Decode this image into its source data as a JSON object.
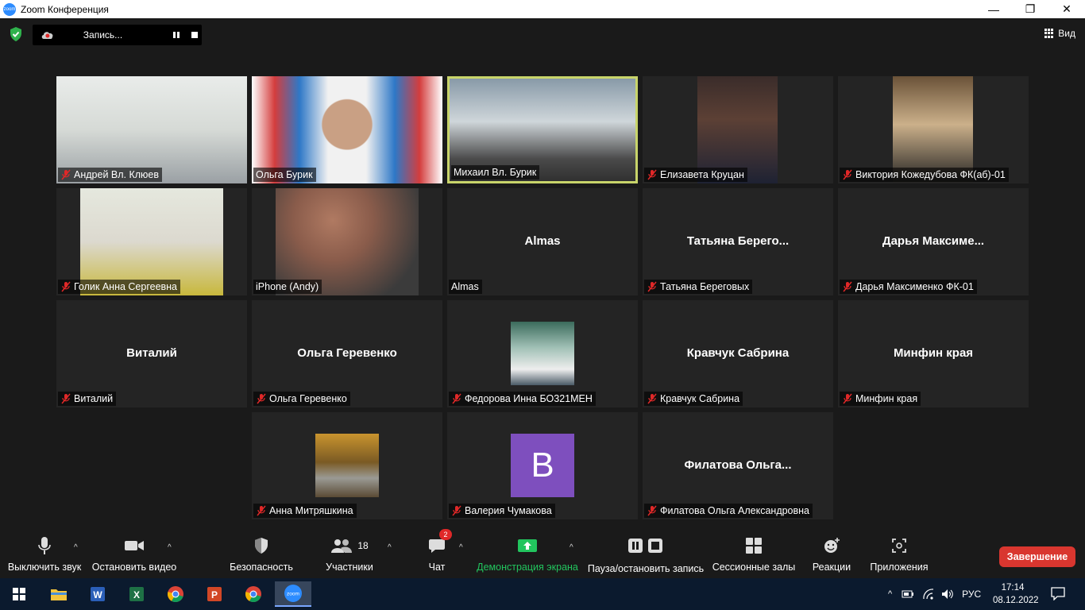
{
  "window": {
    "title": "Zoom Конференция"
  },
  "recording": {
    "label": "Запись..."
  },
  "view": {
    "label": "Вид"
  },
  "tiles": [
    {
      "name": "Андрей Вл. Клюев",
      "muted": true
    },
    {
      "name": "Ольга Бурик",
      "muted": false
    },
    {
      "name": "Михаил Вл. Бурик",
      "muted": false,
      "active": true
    },
    {
      "name": "Елизавета Крyцан",
      "muted": true
    },
    {
      "name": "Виктория Кожедубова ФК(аб)-01",
      "muted": true
    },
    {
      "name": "Голик Анна Сергеевна",
      "muted": true
    },
    {
      "name": "iPhone (Andy)",
      "muted": false
    },
    {
      "name": "Almas",
      "center": "Almas",
      "muted": false
    },
    {
      "name": "Татьяна Береговых",
      "center": "Татьяна  Берего...",
      "muted": true
    },
    {
      "name": "Дарья Максименко ФК-01",
      "center": "Дарья  Максиме...",
      "muted": true
    },
    {
      "name": "Виталий",
      "center": "Виталий",
      "muted": true
    },
    {
      "name": "Ольга Геревенко",
      "center": "Ольга Геревенко",
      "muted": true
    },
    {
      "name": "Федорова Инна БО321МЕН",
      "muted": true
    },
    {
      "name": "Кравчук Сабрина",
      "center": "Кравчук Сабрина",
      "muted": true
    },
    {
      "name": "Минфин края",
      "center": "Минфин края",
      "muted": true
    },
    {
      "name": "Анна Митряшкина",
      "muted": true
    },
    {
      "name": "Валерия Чумакова",
      "avatar_letter": "B",
      "muted": true
    },
    {
      "name": "Филатова Ольга Александровна",
      "center": "Филатова  Ольга...",
      "muted": true
    }
  ],
  "toolbar": {
    "mute": "Выключить звук",
    "video": "Остановить видео",
    "security": "Безопасность",
    "participants": "Участники",
    "participants_count": "18",
    "chat": "Чат",
    "chat_badge": "2",
    "share": "Демонстрация экрана",
    "record": "Пауза/остановить запись",
    "breakout": "Сессионные залы",
    "reactions": "Реакции",
    "apps": "Приложения",
    "end": "Завершение"
  },
  "taskbar": {
    "lang": "РУС",
    "time": "17:14",
    "date": "08.12.2022",
    "apps": [
      "windows-start",
      "file-explorer",
      "word",
      "excel",
      "chrome",
      "powerpoint",
      "chrome",
      "zoom"
    ]
  },
  "colors": {
    "active_border": "#c8d46a",
    "share_green": "#22c55e",
    "end_red": "#d9362f",
    "avatar_purple": "#7e4fbe"
  }
}
